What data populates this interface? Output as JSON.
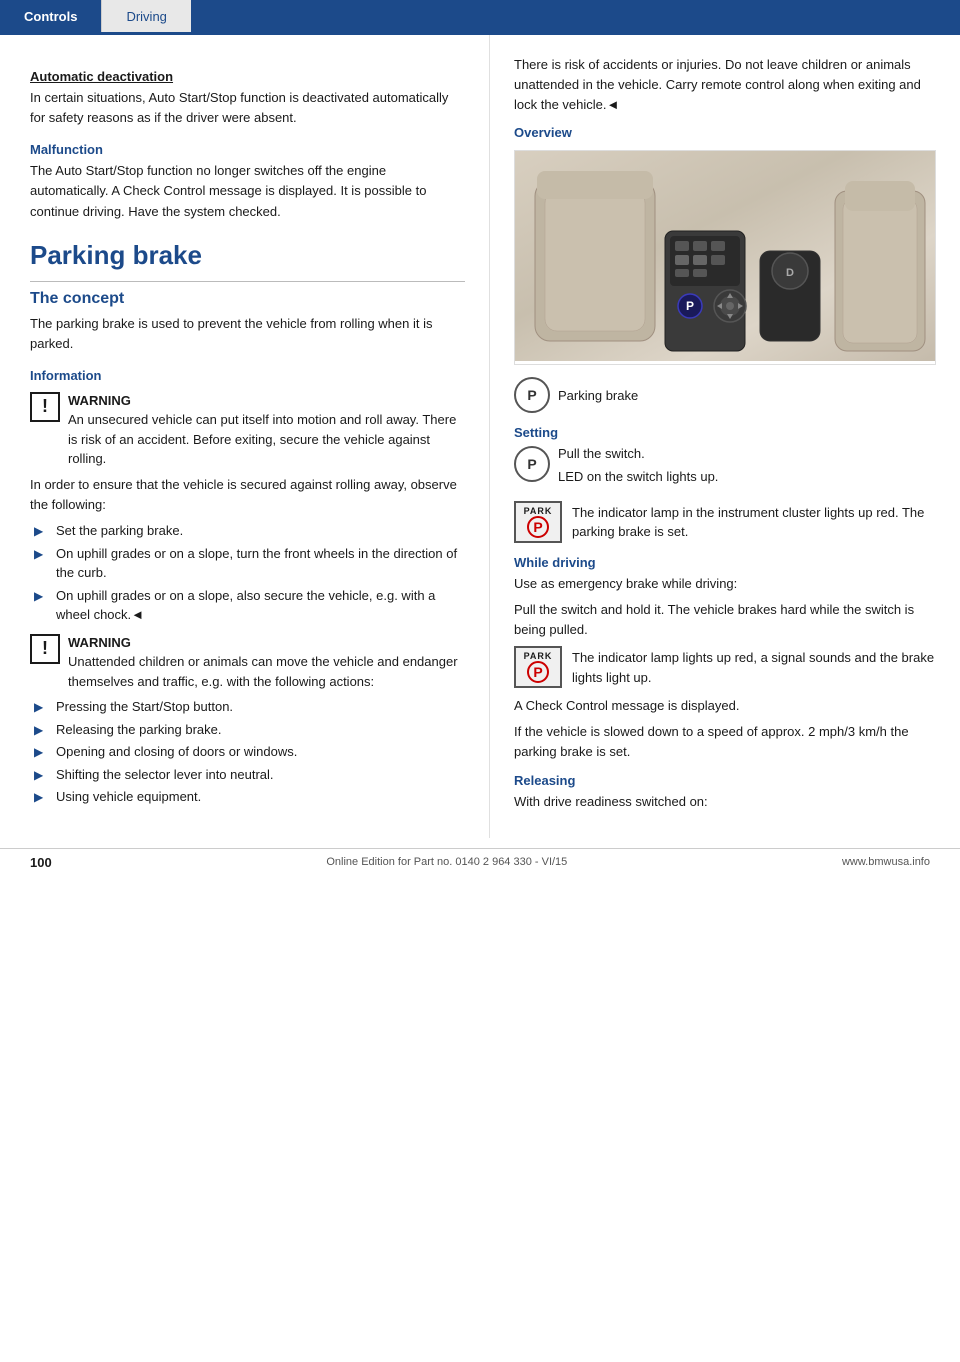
{
  "tabs": {
    "active": "Controls",
    "inactive": "Driving"
  },
  "left": {
    "auto_deactivation_heading": "Automatic deactivation",
    "auto_deactivation_text": "In certain situations, Auto Start/Stop function is deactivated automatically for safety reasons as if the driver were absent.",
    "malfunction_heading": "Malfunction",
    "malfunction_text": "The Auto Start/Stop function no longer switches off the engine automatically. A Check Control message is displayed. It is possible to continue driving. Have the system checked.",
    "parking_brake_heading": "Parking brake",
    "the_concept_heading": "The concept",
    "the_concept_text": "The parking brake is used to prevent the vehicle from rolling when it is parked.",
    "information_heading": "Information",
    "warning1_label": "WARNING",
    "warning1_text": "An unsecured vehicle can put itself into motion and roll away. There is risk of an accident. Before exiting, secure the vehicle against rolling.",
    "in_order_text": "In order to ensure that the vehicle is secured against rolling away, observe the following:",
    "bullets1": [
      "Set the parking brake.",
      "On uphill grades or on a slope, turn the front wheels in the direction of the curb.",
      "On uphill grades or on a slope, also secure the vehicle, e.g. with a wheel chock.◄"
    ],
    "warning2_label": "WARNING",
    "warning2_text": "Unattended children or animals can move the vehicle and endanger themselves and traffic, e.g. with the following actions:",
    "bullets2": [
      "Pressing the Start/Stop button.",
      "Releasing the parking brake.",
      "Opening and closing of doors or windows.",
      "Shifting the selector lever into neutral.",
      "Using vehicle equipment."
    ]
  },
  "right": {
    "intro_text": "There is risk of accidents or injuries. Do not leave children or animals unattended in the vehicle. Carry remote control along when exiting and lock the vehicle.◄",
    "overview_heading": "Overview",
    "parking_brake_icon_label": "Parking brake",
    "setting_heading": "Setting",
    "setting_step1": "Pull the switch.",
    "setting_step2": "LED on the switch lights up.",
    "setting_indicator_text": "The indicator lamp in the instrument cluster lights up red. The parking brake is set.",
    "while_driving_heading": "While driving",
    "while_driving_text1": "Use as emergency brake while driving:",
    "while_driving_text2": "Pull the switch and hold it. The vehicle brakes hard while the switch is being pulled.",
    "while_driving_indicator_text": "The indicator lamp lights up red, a signal sounds and the brake lights light up.",
    "check_control_text": "A Check Control message is displayed.",
    "slowed_text": "If the vehicle is slowed down to a speed of approx. 2 mph/3 km/h the parking brake is set.",
    "releasing_heading": "Releasing",
    "releasing_text": "With drive readiness switched on:"
  },
  "footer": {
    "page_number": "100",
    "edition_text": "Online Edition for Part no. 0140 2 964 330 - VI/15",
    "website": "www.bmwusa.info"
  },
  "icons": {
    "warning_symbol": "!",
    "bullet_arrow": "▶",
    "park_label": "PARK",
    "park_p": "P"
  }
}
